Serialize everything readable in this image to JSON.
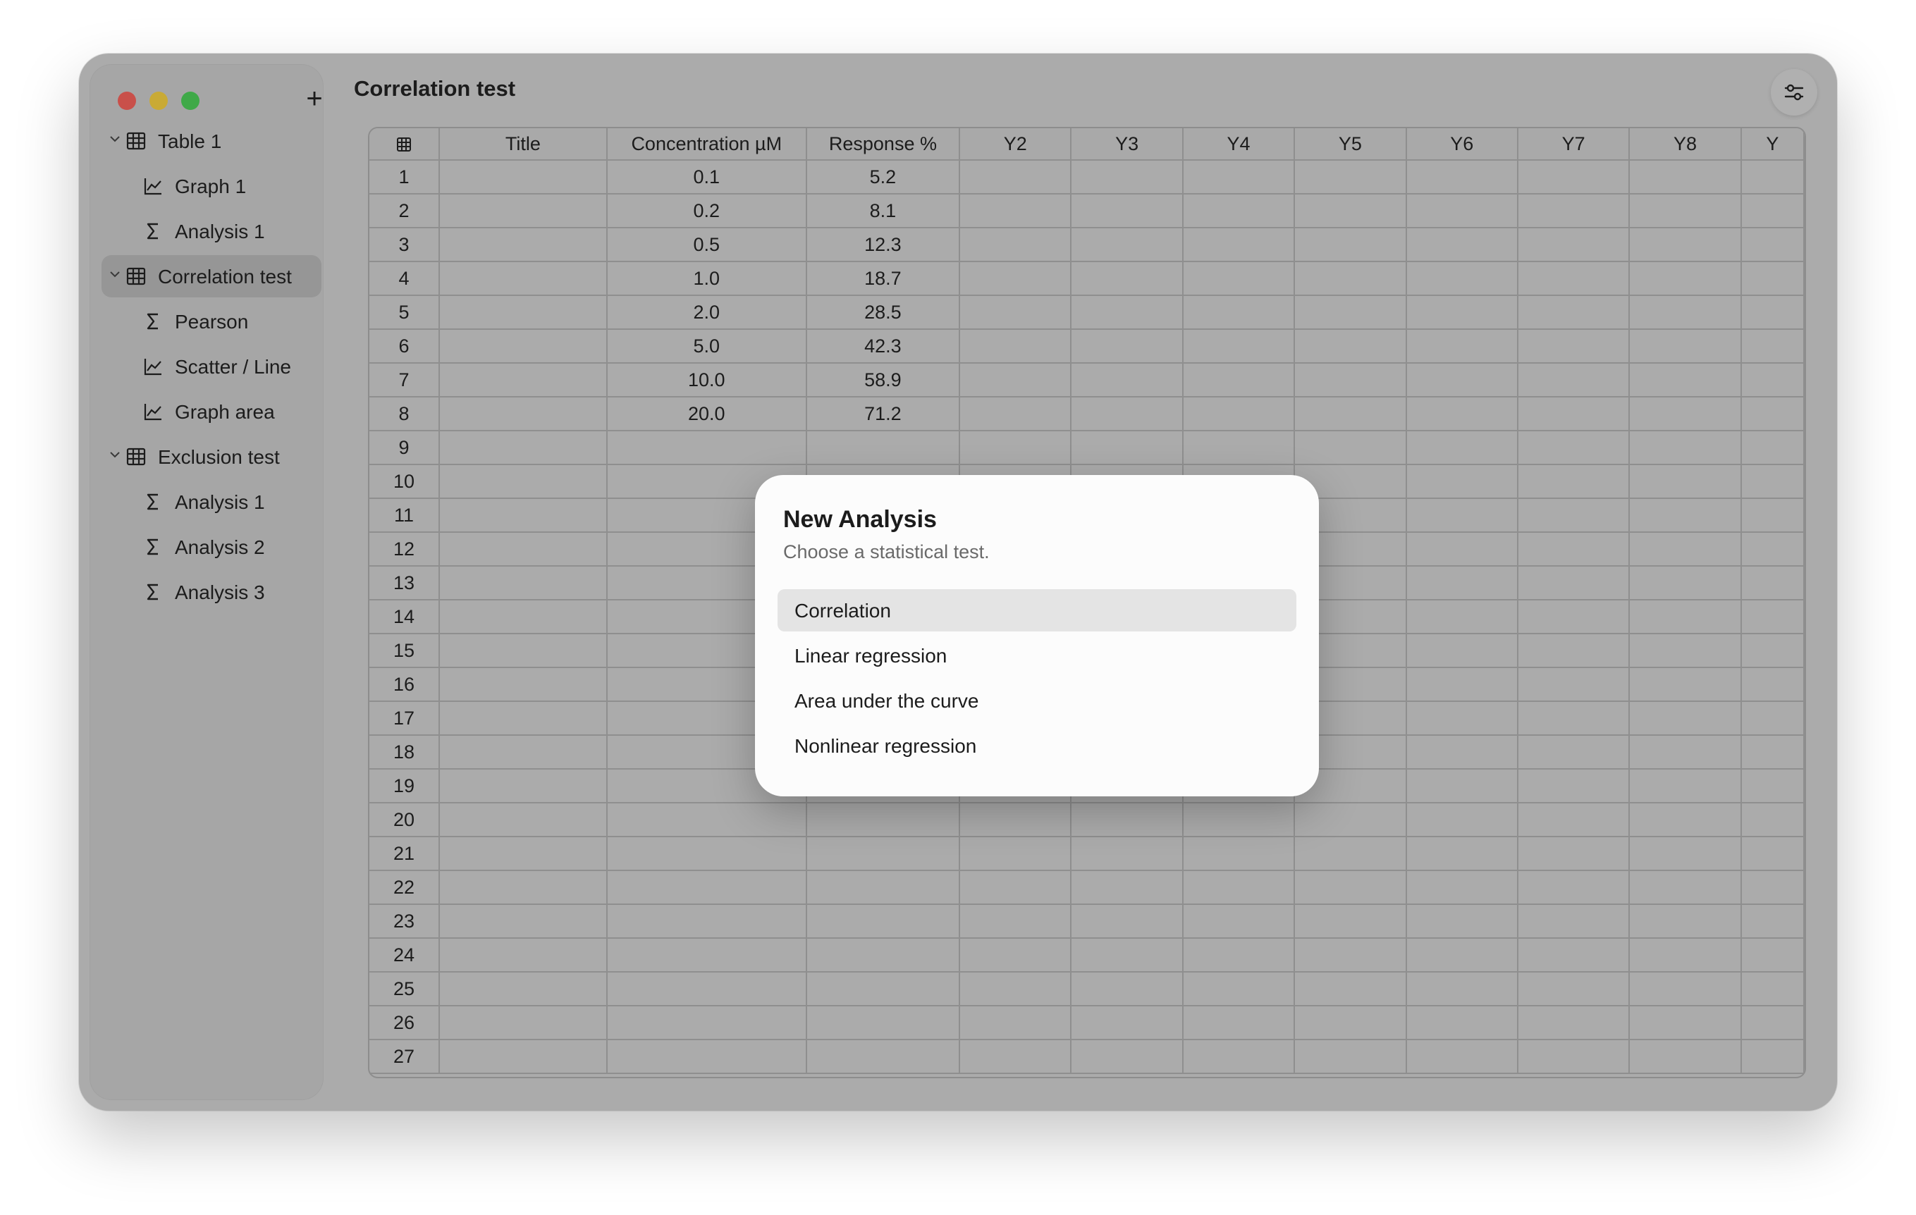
{
  "sidebar": {
    "new_button": "+",
    "items": [
      {
        "label": "Table 1",
        "type": "table",
        "level": 0,
        "expanded": true,
        "selected": false
      },
      {
        "label": "Graph 1",
        "type": "graph",
        "level": 1,
        "selected": false
      },
      {
        "label": "Analysis 1",
        "type": "analysis",
        "level": 1,
        "selected": false
      },
      {
        "label": "Correlation test",
        "type": "table",
        "level": 0,
        "expanded": true,
        "selected": true
      },
      {
        "label": "Pearson",
        "type": "analysis",
        "level": 1,
        "selected": false
      },
      {
        "label": "Scatter / Line",
        "type": "graph",
        "level": 1,
        "selected": false
      },
      {
        "label": "Graph area",
        "type": "graph",
        "level": 1,
        "selected": false
      },
      {
        "label": "Exclusion test",
        "type": "table",
        "level": 0,
        "expanded": true,
        "selected": false
      },
      {
        "label": "Analysis 1",
        "type": "analysis",
        "level": 1,
        "selected": false
      },
      {
        "label": "Analysis 2",
        "type": "analysis",
        "level": 1,
        "selected": false
      },
      {
        "label": "Analysis 3",
        "type": "analysis",
        "level": 1,
        "selected": false
      }
    ]
  },
  "header": {
    "title": "Correlation test",
    "settings_icon": "sliders-icon"
  },
  "table": {
    "columns": [
      "Title",
      "Concentration µM",
      "Response %",
      "Y2",
      "Y3",
      "Y4",
      "Y5",
      "Y6",
      "Y7",
      "Y8",
      "Y"
    ],
    "row_count": 27,
    "rows": [
      {
        "concentration": "0.1",
        "response": "5.2"
      },
      {
        "concentration": "0.2",
        "response": "8.1"
      },
      {
        "concentration": "0.5",
        "response": "12.3"
      },
      {
        "concentration": "1.0",
        "response": "18.7"
      },
      {
        "concentration": "2.0",
        "response": "28.5"
      },
      {
        "concentration": "5.0",
        "response": "42.3"
      },
      {
        "concentration": "10.0",
        "response": "58.9"
      },
      {
        "concentration": "20.0",
        "response": "71.2"
      }
    ]
  },
  "modal": {
    "title": "New Analysis",
    "subtitle": "Choose a statistical test.",
    "options": [
      {
        "label": "Correlation",
        "highlighted": true
      },
      {
        "label": "Linear regression",
        "highlighted": false
      },
      {
        "label": "Area under the curve",
        "highlighted": false
      },
      {
        "label": "Nonlinear regression",
        "highlighted": false
      }
    ]
  }
}
